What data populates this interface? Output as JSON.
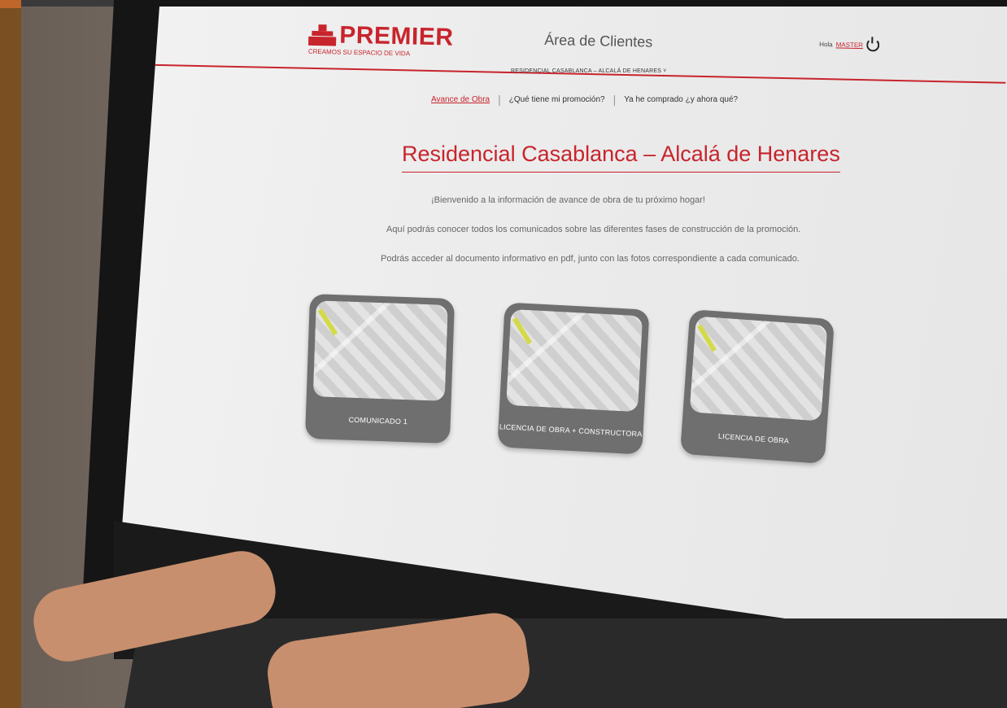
{
  "header": {
    "logo_text": "PREMIER",
    "logo_tagline": "CREAMOS SU ESPACIO DE VIDA",
    "area_title": "Área de Clientes",
    "hello_label": "Hola",
    "username": "MASTER"
  },
  "promotion_selector": "RESIDENCIAL CASABLANCA – ALCALÁ DE HENARES ˅",
  "nav": {
    "items": [
      {
        "label": "Avance de Obra"
      },
      {
        "label": "¿Qué tiene mi promoción?"
      },
      {
        "label": "Ya he comprado ¿y ahora qué?"
      }
    ],
    "separator": "|"
  },
  "main": {
    "title": "Residencial Casablanca – Alcalá de Henares",
    "intro_lines": [
      "¡Bienvenido a la información de avance de obra de tu próximo hogar!",
      "Aquí podrás conocer todos los comunicados sobre las diferentes fases de construcción de la promoción.",
      "Podrás acceder al documento informativo en pdf, junto con las fotos correspondiente a cada comunicado."
    ]
  },
  "cards": [
    {
      "label": "COMUNICADO 1"
    },
    {
      "label": "LICENCIA DE OBRA + CONSTRUCTORA"
    },
    {
      "label": "LICENCIA DE OBRA"
    }
  ],
  "colors": {
    "brand_red": "#c8242c",
    "card_gray": "#6f6f6f",
    "screen_bg": "#eeeeee"
  }
}
